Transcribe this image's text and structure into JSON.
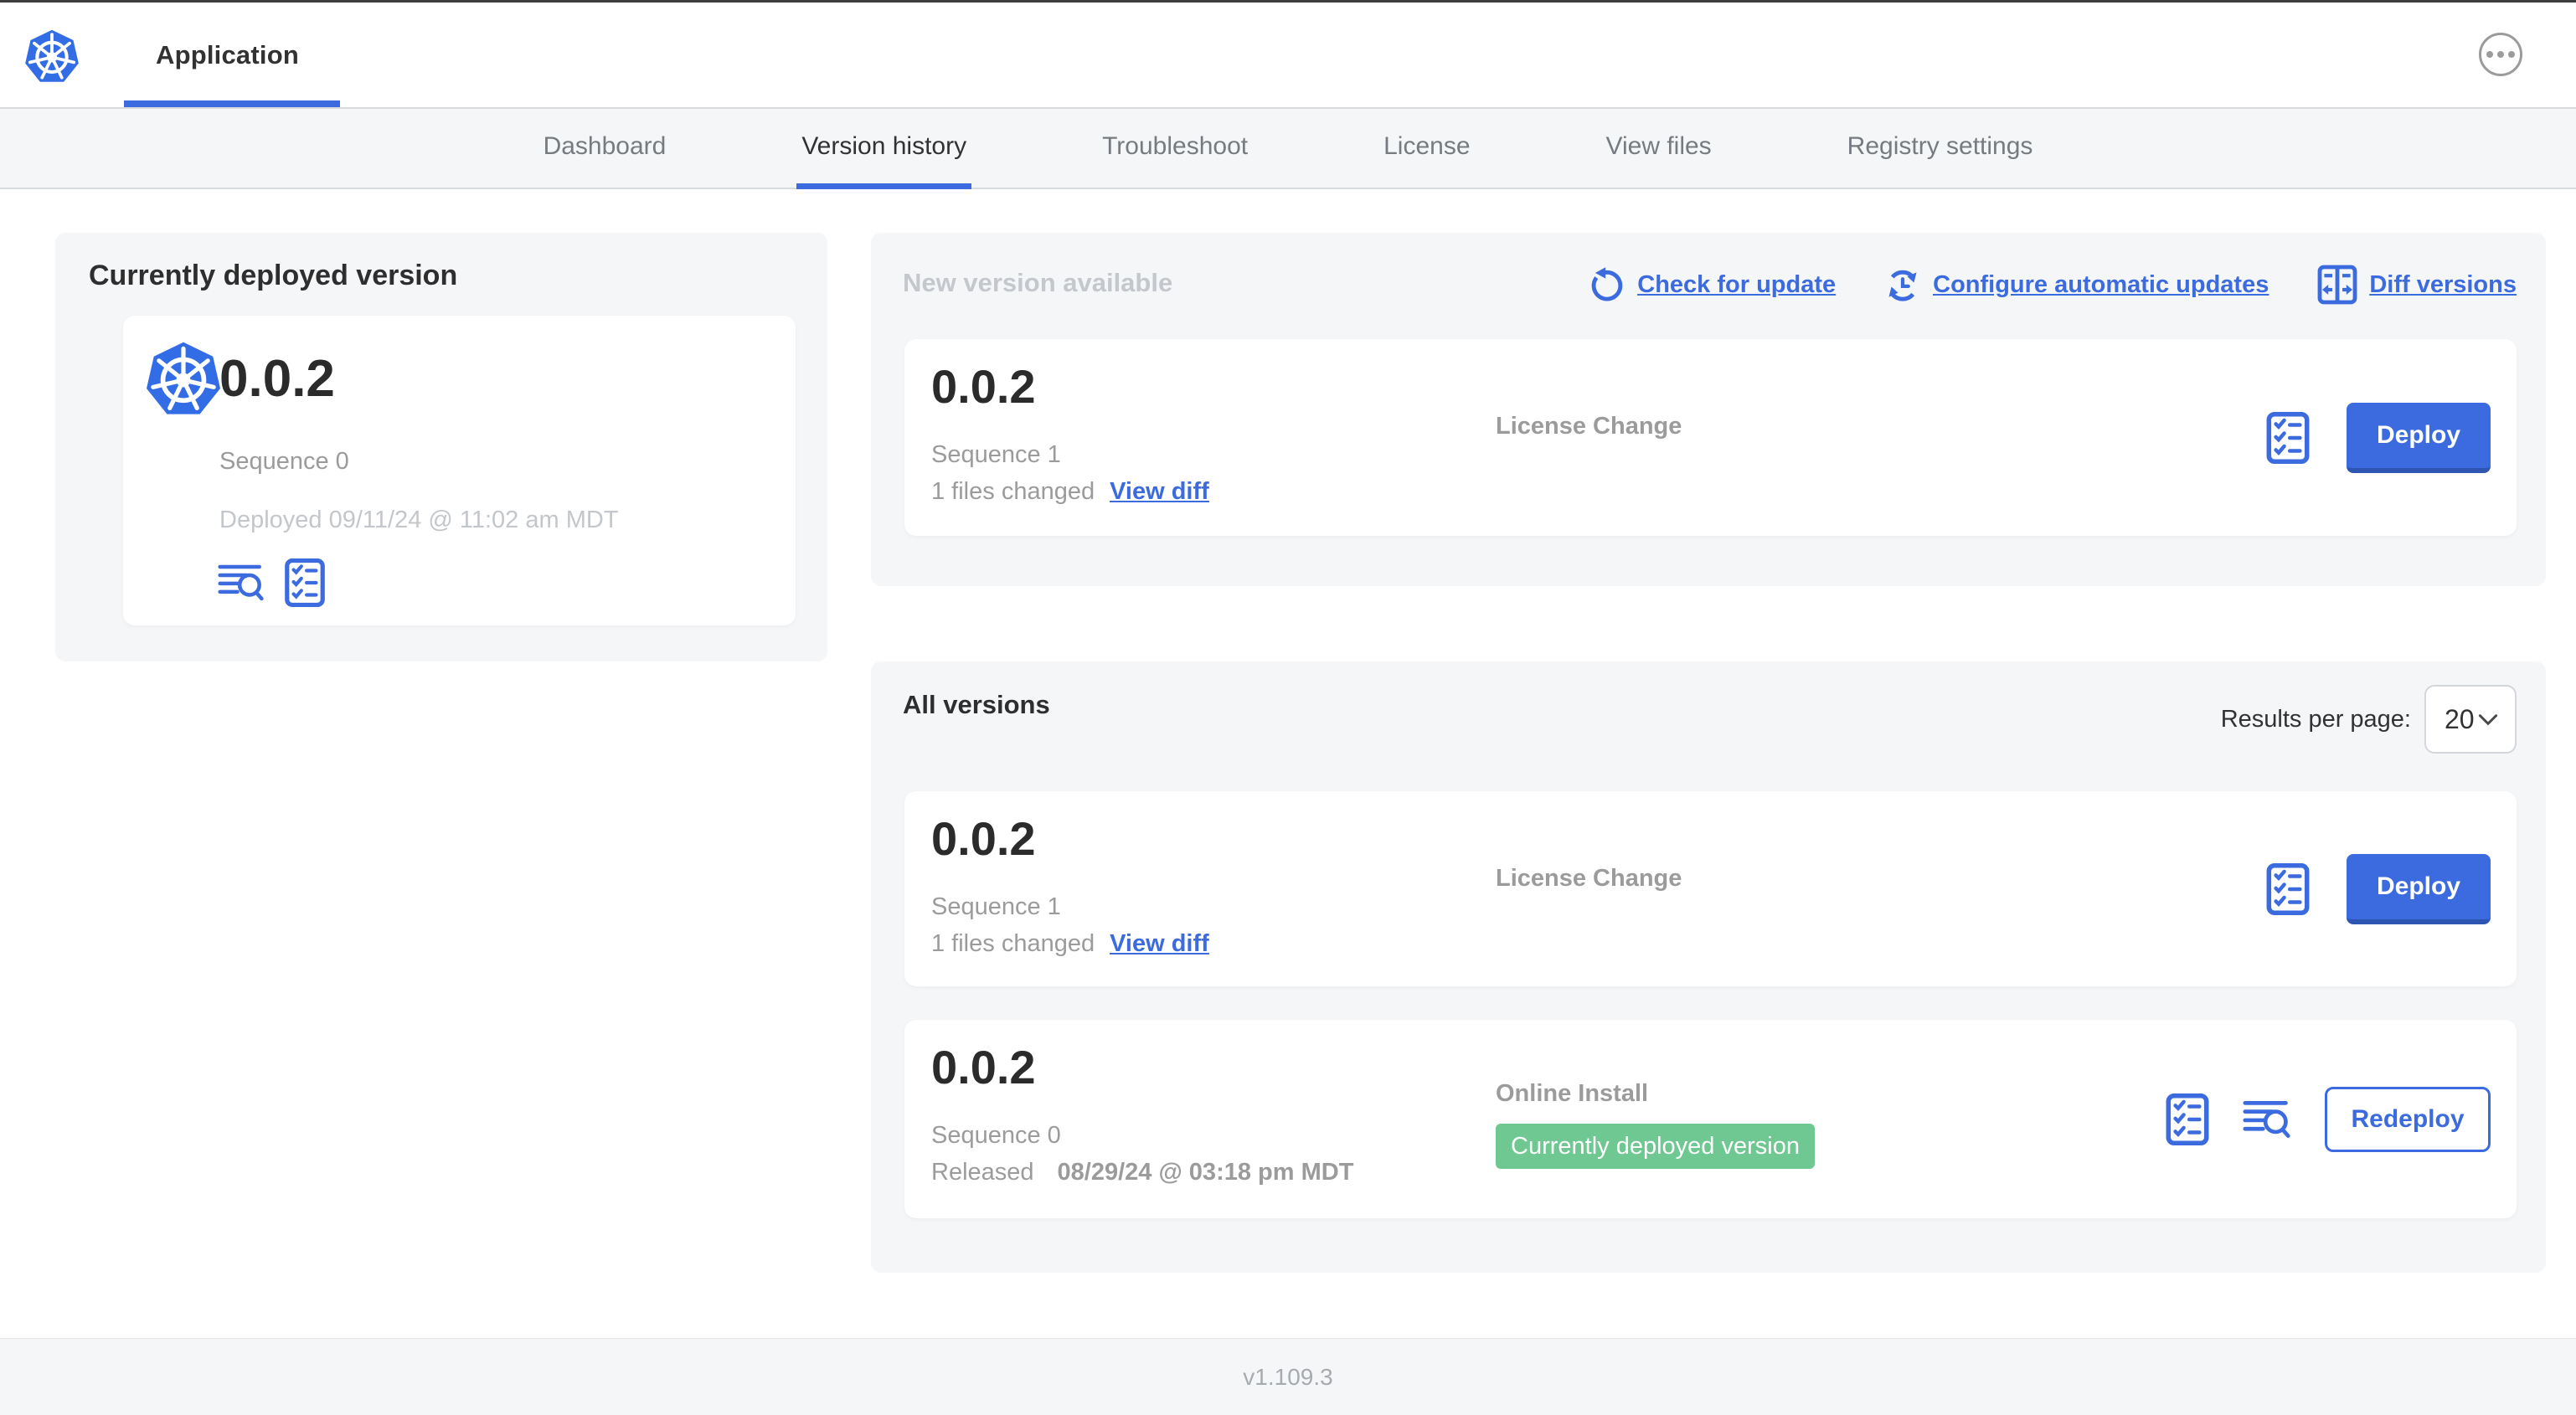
{
  "colors": {
    "accent_blue": "#3b6bde",
    "k8s_blue": "#326de6",
    "badge_green": "#6fc791",
    "muted_bg": "#f5f6f8",
    "text_dark": "#323232",
    "text_gray": "#9b9b9b",
    "text_light": "#c3c7cb"
  },
  "header": {
    "title": "Application",
    "more_icon": "ellipsis-icon"
  },
  "nav": {
    "tabs": [
      {
        "label": "Dashboard"
      },
      {
        "label": "Version history",
        "active": true
      },
      {
        "label": "Troubleshoot"
      },
      {
        "label": "License"
      },
      {
        "label": "View files"
      },
      {
        "label": "Registry settings"
      }
    ]
  },
  "current_card": {
    "title": "Currently deployed version",
    "version": "0.0.2",
    "sequence": "Sequence 0",
    "deployed": "Deployed 09/11/24 @ 11:02 am MDT",
    "icons": [
      "logs-icon",
      "checklist-icon"
    ]
  },
  "new_version": {
    "title": "New version available",
    "actions": [
      {
        "icon": "refresh-icon",
        "label": "Check for update"
      },
      {
        "icon": "auto-update-clock-icon",
        "label": "Configure automatic updates"
      },
      {
        "icon": "diff-icon",
        "label": "Diff versions"
      }
    ],
    "row": {
      "version": "0.0.2",
      "sequence": "Sequence 1",
      "changes": "1 files changed",
      "diff_link": "View diff",
      "source": "License Change",
      "action_label": "Deploy"
    }
  },
  "all_versions": {
    "title": "All versions",
    "results_per_page_label": "Results per page:",
    "results_per_page_value": "20",
    "rows": [
      {
        "version": "0.0.2",
        "sequence": "Sequence 1",
        "changes": "1 files changed",
        "diff_link": "View diff",
        "source": "License Change",
        "action_label": "Deploy"
      },
      {
        "version": "0.0.2",
        "sequence": "Sequence 0",
        "released_prefix": "Released",
        "released_date": "08/29/24 @ 03:18 pm MDT",
        "source": "Online Install",
        "badge": "Currently deployed version",
        "action_label": "Redeploy"
      }
    ]
  },
  "footer": {
    "version": "v1.109.3"
  }
}
